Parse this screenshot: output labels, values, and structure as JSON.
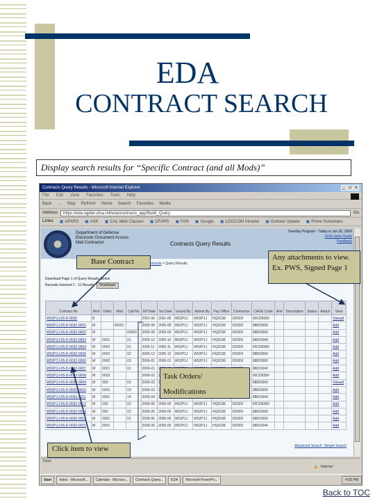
{
  "slide": {
    "title_line1": "EDA",
    "title_line2": "CONTRACT SEARCH",
    "subtitle": "Display search results for “Specific Contract (and all Mods)”",
    "back_link": "Back to TOC",
    "colors": {
      "navy": "#003366",
      "khaki": "#c9c79f",
      "callout_bg": "#c9c79a"
    }
  },
  "callouts": {
    "base_contract": "Base Contract",
    "attachments": "Any attachments to view.  Ex. PWS, Signed Page 1",
    "task_orders_line1": "Task Orders/",
    "task_orders_line2": "Modifications",
    "click_item": "Click item to view"
  },
  "browser": {
    "window_title": "Contracts Query Results - Microsoft Internet Explorer",
    "menu": [
      "File",
      "Edit",
      "View",
      "Favorites",
      "Tools",
      "Help"
    ],
    "toolbar": [
      "Back",
      "→",
      "Stop",
      "Refresh",
      "Home",
      "Search",
      "Favorites",
      "Media"
    ],
    "address_label": "Address",
    "address_value": "https://eda.ogden.disa.mil/eda/contracts_app/Build_Query",
    "go_label": "Go",
    "links_label": "Links",
    "links": [
      "AFARS",
      "ASK",
      "CAL Web Classes",
      "DFARS",
      "FAR",
      "Google",
      "LOGCOM Intranet",
      "Outlook Update",
      "Prime Schedules"
    ],
    "status_zone": "Internet",
    "status_text": "Done"
  },
  "page": {
    "org_lines": [
      "Department of Defense",
      "Electronic Document Access",
      "Mail Contractor"
    ],
    "header_title": "Contracts Query Results",
    "header_right": [
      "Tuesday Program - Today is Jun 20, 2006",
      "EDA Users Guide",
      "Feedback"
    ],
    "breadcrumb": [
      "Contracts",
      "Query Results"
    ],
    "download_line1": "Download Page 1 of Query Results Below",
    "download_line2": "Records returned 1 - 11 Results",
    "download_button": "Download",
    "columns": [
      "Contract No",
      "Mod",
      "Order",
      "Mod",
      "Call No",
      "Eff Date",
      "Iss Date",
      "Issued By",
      "Admin By",
      "Pay Office",
      "Contractor",
      "CAGE Code",
      "Amt",
      "Description",
      "Status",
      "Attach",
      "View"
    ],
    "rows": [
      {
        "contract": "W52P1J-05-D-0032",
        "type": "B",
        "order": "",
        "mod": "",
        "call": "",
        "eff": "2001-06",
        "iss": "2001-06",
        "issued": "W52P1J",
        "admin": "W52P1J",
        "pay": "HQ0338",
        "con": "0D0D0",
        "cage": "00CD8380",
        "view": "Viewall"
      },
      {
        "contract": "W52P1J-05-D-0032-0001",
        "type": "M",
        "order": "",
        "mod": "00001",
        "call": "",
        "eff": "2005-08",
        "iss": "2005-08",
        "issued": "W52P1J",
        "admin": "W52P1J",
        "pay": "HQ0338",
        "con": "0D0D0",
        "cage": "98820000",
        "view": "Add"
      },
      {
        "contract": "W52P1J-05-D-0032-0002",
        "type": "M",
        "order": "",
        "mod": "",
        "call": "00002",
        "eff": "2005-09",
        "iss": "2005-09",
        "issued": "W52P1J",
        "admin": "W52P1J",
        "pay": "HQ0338",
        "con": "0D0D0",
        "cage": "98820000",
        "view": "Add"
      },
      {
        "contract": "W52P1J-05-D-0032-0003",
        "type": "M",
        "order": "0001",
        "mod": "",
        "call": "01",
        "eff": "2005-10",
        "iss": "2005-10",
        "issued": "W52P1J",
        "admin": "W52P1J",
        "pay": "HQ0338",
        "con": "0D0D0",
        "cage": "98815040",
        "view": "Add"
      },
      {
        "contract": "W52P1J-05-D-0032-0004",
        "type": "M",
        "order": "0002",
        "mod": "",
        "call": "01",
        "eff": "2005-11",
        "iss": "2005-11",
        "issued": "W52P1J",
        "admin": "W52P1J",
        "pay": "HQ0338",
        "con": "0D0D0",
        "cage": "00CD8380",
        "view": "Add"
      },
      {
        "contract": "W52P1J-05-D-0032-0005",
        "type": "M",
        "order": "0002",
        "mod": "",
        "call": "02",
        "eff": "2005-12",
        "iss": "2005-12",
        "issued": "W52P1J",
        "admin": "W52P1J",
        "pay": "HQ0338",
        "con": "0D0D0",
        "cage": "98820000",
        "view": "Add"
      },
      {
        "contract": "W52P1J-05-D-0032-0006",
        "type": "M",
        "order": "0002",
        "mod": "",
        "call": "03",
        "eff": "2006-01",
        "iss": "2006-01",
        "issued": "W52P1J",
        "admin": "W52P1J",
        "pay": "HQ0338",
        "con": "0D0D0",
        "cage": "98820000",
        "view": "Add"
      },
      {
        "contract": "W52P1J-05-D-0032-0007",
        "type": "M",
        "order": "0001",
        "mod": "",
        "call": "01",
        "eff": "2006-01",
        "iss": "2006-01",
        "issued": "W52P1J",
        "admin": "W52P1J",
        "pay": "HQ0338",
        "con": "0D0D0",
        "cage": "98815040",
        "view": "Add"
      },
      {
        "contract": "W52P1J-05-D-0032-0008",
        "type": "M",
        "order": "0003",
        "mod": "",
        "call": "",
        "eff": "2006-02",
        "iss": "2006-02",
        "issued": "W52P1J",
        "admin": "W52P1J",
        "pay": "HQ0338",
        "con": "0D0D0",
        "cage": "00CD8380",
        "view": "Add"
      },
      {
        "contract": "W52P1J-05-D-0032-0009",
        "type": "M",
        "order": "000",
        "mod": "",
        "call": "03",
        "eff": "2006-03",
        "iss": "2006-03",
        "issued": "W52P1J",
        "admin": "W52P1J",
        "pay": "HQ0338",
        "con": "0D0D0",
        "cage": "98820000",
        "view": "Viewall"
      },
      {
        "contract": "W52P1J-05-D-0032-0010",
        "type": "M",
        "order": "0001",
        "mod": "",
        "call": "03",
        "eff": "2006-03",
        "iss": "2006-03",
        "issued": "W52P1J",
        "admin": "W52P1J",
        "pay": "HQ0338",
        "con": "0D0D0",
        "cage": "98820000",
        "view": "Add"
      },
      {
        "contract": "W52P1J-05-D-0032-0011",
        "type": "M",
        "order": "0001",
        "mod": "",
        "call": "14",
        "eff": "2006-04",
        "iss": "2006-04",
        "issued": "W52P1J",
        "admin": "W52P1J",
        "pay": "HQ0338",
        "con": "0D0D0",
        "cage": "98815040",
        "view": "Add"
      },
      {
        "contract": "W52P1J-05-D-0032-0012",
        "type": "M",
        "order": "000",
        "mod": "",
        "call": "02",
        "eff": "2006-05",
        "iss": "2006-05",
        "issued": "W52P1J",
        "admin": "W52P1J",
        "pay": "HQ0338",
        "con": "0D0D0",
        "cage": "00CD8380",
        "view": "Add"
      },
      {
        "contract": "W52P1J-05-D-0032-0013",
        "type": "M",
        "order": "000",
        "mod": "",
        "call": "02",
        "eff": "2006-06",
        "iss": "2006-06",
        "issued": "W52P1J",
        "admin": "W52P1J",
        "pay": "HQ0338",
        "con": "0D0D0",
        "cage": "98820000",
        "view": "Add"
      },
      {
        "contract": "W52P1J-05-D-0032-0014",
        "type": "M",
        "order": "0001",
        "mod": "",
        "call": "01",
        "eff": "2006-06",
        "iss": "2006-06",
        "issued": "W52P1J",
        "admin": "W52P1J",
        "pay": "HQ0338",
        "con": "0D0D0",
        "cage": "98820000",
        "view": "Add"
      },
      {
        "contract": "W52P1J-05-D-0032-0015",
        "type": "M",
        "order": "0001",
        "mod": "",
        "call": "",
        "eff": "2006-06",
        "iss": "2006-06",
        "issued": "W52P1J",
        "admin": "W52P1J",
        "pay": "HQ0338",
        "con": "0D0D0",
        "cage": "98815040",
        "view": "Add"
      }
    ],
    "footer_links": [
      "Advanced Search",
      "Simple Search"
    ]
  },
  "taskbar": {
    "start": "Start",
    "tasks": [
      "Inbox - Microsoft...",
      "Calendar - Microso...",
      "Contracts Query...",
      "EDA",
      "Microsoft PowerPo..."
    ],
    "clock": "4:00 PM"
  }
}
